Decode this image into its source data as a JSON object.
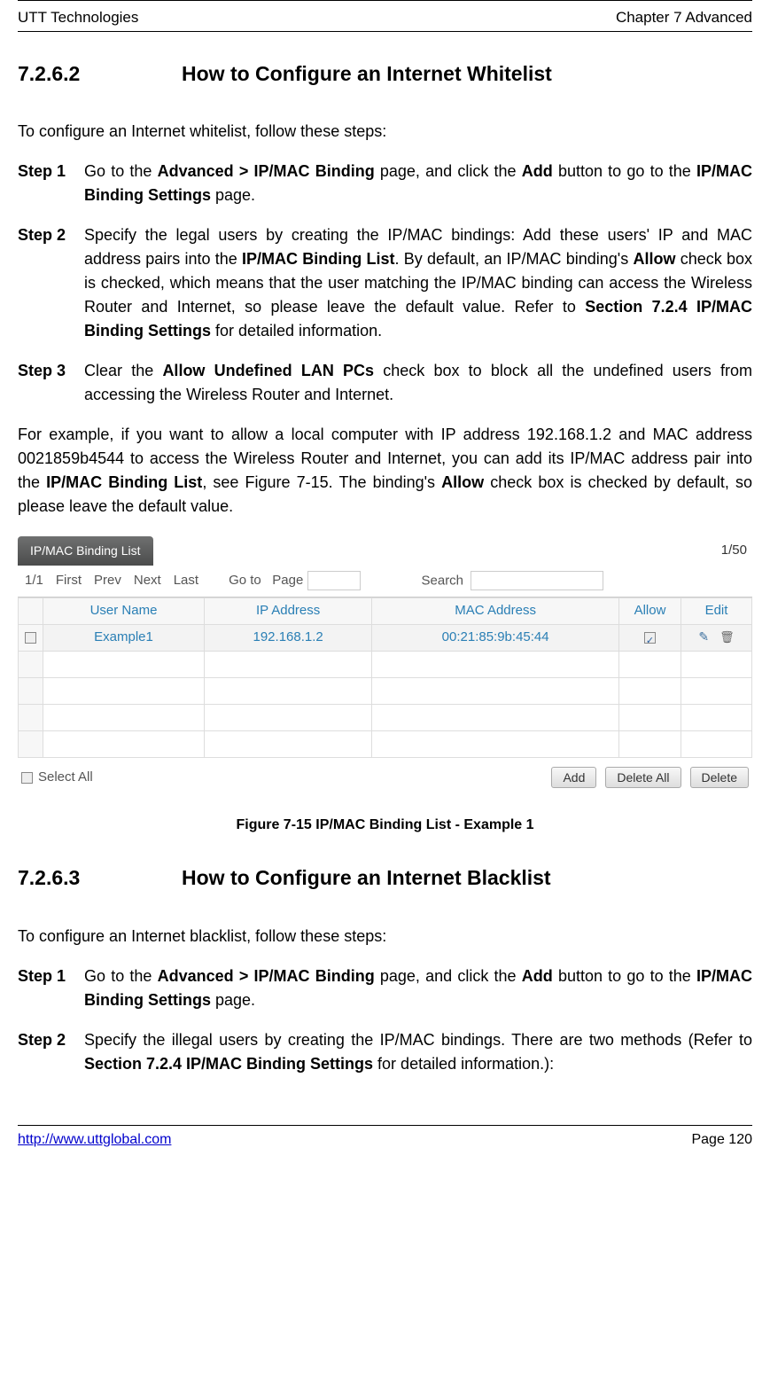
{
  "header": {
    "left": "UTT Technologies",
    "right": "Chapter 7 Advanced"
  },
  "section_a": {
    "number": "7.2.6.2",
    "title": "How to Configure an Internet Whitelist",
    "intro": "To configure an Internet whitelist, follow these steps:",
    "steps": [
      {
        "label": "Step 1",
        "html": "Go to the <b>Advanced > IP/MAC Binding</b> page, and click the <b>Add</b> button to go to the <b>IP/MAC Binding Settings</b> page."
      },
      {
        "label": "Step 2",
        "html": "Specify the legal users by creating the IP/MAC bindings: Add these users' IP and MAC address pairs into the <b>IP/MAC Binding List</b>. By default, an IP/MAC binding's <b>Allow</b> check box is checked, which means that the user matching the IP/MAC binding can access the Wireless Router and Internet, so please leave the default value. Refer to <b>Section 7.2.4 IP/MAC Binding Settings</b> for detailed information."
      },
      {
        "label": "Step 3",
        "html": "Clear the <b>Allow Undefined LAN PCs</b> check box to block all the undefined users from accessing the Wireless Router and Internet."
      }
    ],
    "example_html": "For example, if you want to allow a local computer with IP address 192.168.1.2 and MAC address 0021859b4544 to access the Wireless Router and Internet, you can add its IP/MAC address pair into the <b>IP/MAC Binding List</b>, see Figure 7-15. The binding's <b>Allow</b> check box is checked by default, so please leave the default value."
  },
  "screenshot": {
    "panel_title": "IP/MAC Binding List",
    "page_ratio": "1/50",
    "pager": {
      "current": "1/1",
      "first": "First",
      "prev": "Prev",
      "next": "Next",
      "last": "Last",
      "goto_label": "Go to",
      "page_label": "Page",
      "search_label": "Search"
    },
    "columns": [
      "User Name",
      "IP Address",
      "MAC Address",
      "Allow",
      "Edit"
    ],
    "rows": [
      {
        "user": "Example1",
        "ip": "192.168.1.2",
        "mac": "00:21:85:9b:45:44",
        "allow": true
      }
    ],
    "empty_rows": 4,
    "select_all_label": "Select All",
    "buttons": {
      "add": "Add",
      "delete_all": "Delete All",
      "delete": "Delete"
    }
  },
  "figure_caption": "Figure 7-15 IP/MAC Binding List - Example 1",
  "section_b": {
    "number": "7.2.6.3",
    "title": "How to Configure an Internet Blacklist",
    "intro": "To configure an Internet blacklist, follow these steps:",
    "steps": [
      {
        "label": "Step 1",
        "html": "Go to the <b>Advanced > IP/MAC Binding</b> page, and click the <b>Add</b> button to go to the <b>IP/MAC Binding Settings</b> page."
      },
      {
        "label": "Step 2",
        "html": "Specify the illegal users by creating the IP/MAC bindings. There are two methods (Refer to <b>Section 7.2.4 IP/MAC Binding Settings</b> for detailed information.):"
      }
    ]
  },
  "footer": {
    "url": "http://www.uttglobal.com",
    "page": "Page 120"
  }
}
